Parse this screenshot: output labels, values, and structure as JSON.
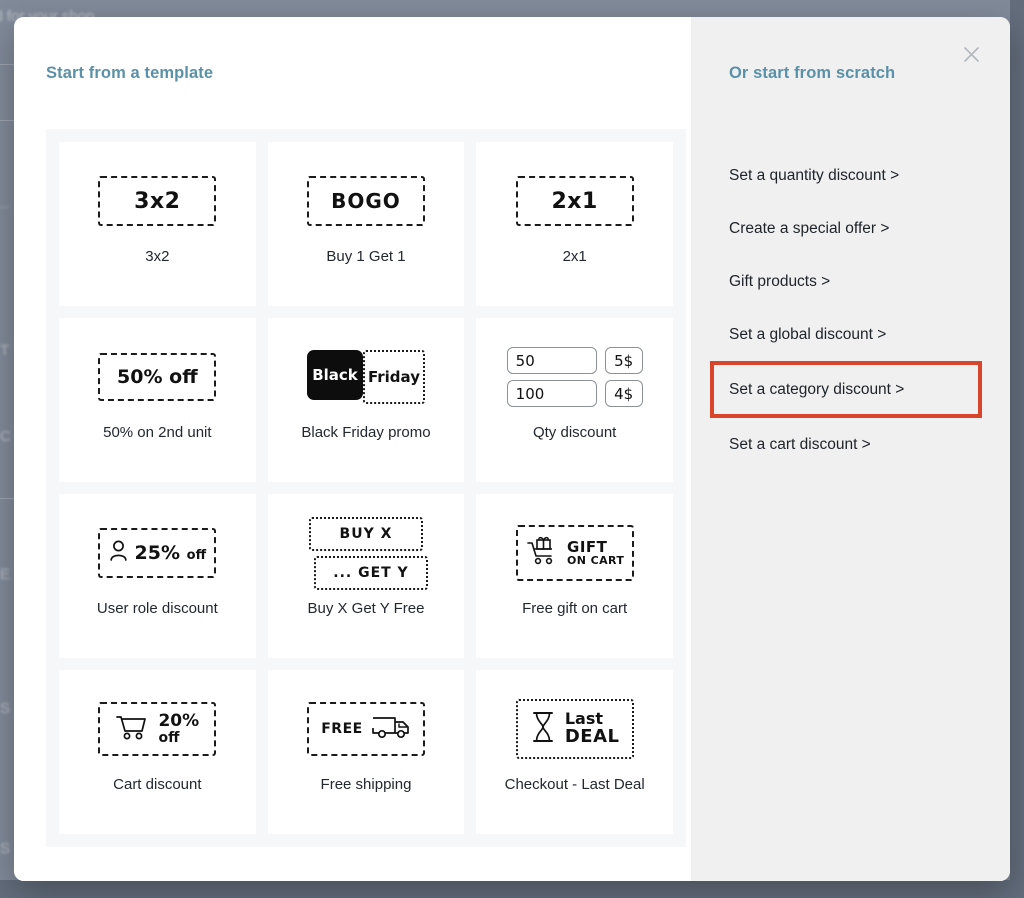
{
  "background": {
    "fragment_top": "ed for your shop",
    "fragments": [
      "...",
      "T",
      "C",
      "E",
      "S",
      "S"
    ]
  },
  "modal": {
    "close_icon": "close-icon",
    "left": {
      "title": "Start from a template",
      "templates": [
        {
          "id": "3x2",
          "label": "3x2",
          "art": "text",
          "art_text": "3x2"
        },
        {
          "id": "buy-1-get-1",
          "label": "Buy 1 Get 1",
          "art": "text",
          "art_text": "BOGO"
        },
        {
          "id": "2x1",
          "label": "2x1",
          "art": "text",
          "art_text": "2x1"
        },
        {
          "id": "50-on-2nd-unit",
          "label": "50% on 2nd unit",
          "art": "text",
          "art_text": "50% off"
        },
        {
          "id": "black-friday",
          "label": "Black Friday promo",
          "art": "blackfriday",
          "art_text_1": "Black",
          "art_text_2": "Friday"
        },
        {
          "id": "qty-discount",
          "label": "Qty discount",
          "art": "qty",
          "rows": [
            [
              "50",
              "5$"
            ],
            [
              "100",
              "4$"
            ]
          ]
        },
        {
          "id": "user-role",
          "label": "User role discount",
          "art": "user-pct",
          "art_text": "25%",
          "art_suffix": "off"
        },
        {
          "id": "buy-x-get-y",
          "label": "Buy X Get Y Free",
          "art": "buyxgety",
          "art_text_1": "BUY X",
          "art_text_2": "... GET Y"
        },
        {
          "id": "free-gift-cart",
          "label": "Free gift on cart",
          "art": "gift-cart",
          "art_text_1": "GIFT",
          "art_text_2": "ON CART"
        },
        {
          "id": "cart-discount",
          "label": "Cart discount",
          "art": "cart-pct",
          "art_text": "20%",
          "art_suffix": "off"
        },
        {
          "id": "free-shipping",
          "label": "Free shipping",
          "art": "truck",
          "art_text": "FREE"
        },
        {
          "id": "checkout-last",
          "label": "Checkout - Last Deal",
          "art": "hourglass",
          "art_text_1": "Last",
          "art_text_2": "DEAL"
        }
      ]
    },
    "right": {
      "title": "Or start from scratch",
      "items": [
        {
          "id": "quantity-discount",
          "label": "Set a quantity discount >",
          "highlighted": false
        },
        {
          "id": "special-offer",
          "label": "Create a special offer >",
          "highlighted": false
        },
        {
          "id": "gift-products",
          "label": "Gift products >",
          "highlighted": false
        },
        {
          "id": "global-discount",
          "label": "Set a global discount >",
          "highlighted": false
        },
        {
          "id": "category-discount",
          "label": "Set a category discount >",
          "highlighted": true
        },
        {
          "id": "cart-discount",
          "label": "Set a cart discount >",
          "highlighted": false
        }
      ]
    }
  },
  "colors": {
    "accent_heading": "#5b91a8",
    "highlight_border": "#d9452a",
    "panel_bg": "#f0f0f1",
    "grid_bg": "#f6f7f8",
    "backdrop": "#636d7c"
  }
}
